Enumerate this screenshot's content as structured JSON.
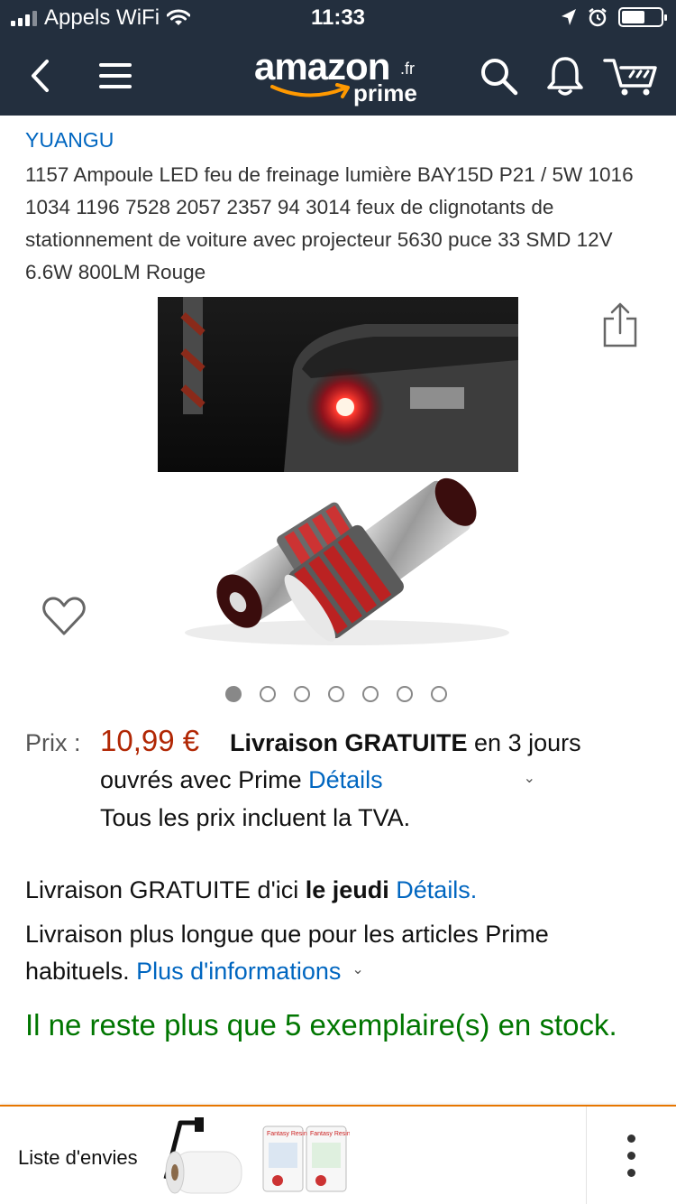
{
  "status_bar": {
    "carrier": "Appels WiFi",
    "time": "11:33",
    "battery_level": 0.6
  },
  "nav": {
    "logo_word": "amazon",
    "logo_tld": ".fr",
    "logo_prime": "prime",
    "icons": [
      "back-icon",
      "menu-icon",
      "search-icon",
      "bell-icon",
      "cart-icon"
    ]
  },
  "product": {
    "brand": "YUANGU",
    "title": "1157 Ampoule LED feu de freinage lumière BAY15D P21 / 5W 1016 1034 1196 7528 2057 2357 94 3014 feux de clignotants de stationnement de voiture avec projecteur 5630 puce 33 SMD 12V 6.6W 800LM Rouge",
    "image_count": 7,
    "active_image": 0
  },
  "pricing": {
    "label": "Prix :",
    "value": "10,99 €",
    "shipping_bold": "Livraison GRATUITE",
    "shipping_rest": " en 3 jours ouvrés avec Prime ",
    "details_link": "Détails",
    "tva": "Tous les prix incluent la TVA."
  },
  "delivery": {
    "line1_text": "Livraison GRATUITE d'ici ",
    "line1_bold": "le jeudi",
    "line1_link": "Détails.",
    "line2_text": "Livraison plus longue que pour les articles Prime habituels. ",
    "line2_link": "Plus d'informations"
  },
  "stock": "Il ne reste plus que 5 exemplaire(s) en stock.",
  "bottom_bar": {
    "wishlist_label": "Liste d'envies",
    "thumb_text": "Fantasy Resin"
  },
  "colors": {
    "header_bg": "#232f3e",
    "link": "#0066c0",
    "price": "#b12704",
    "stock": "#007600",
    "accent": "#e77600"
  }
}
